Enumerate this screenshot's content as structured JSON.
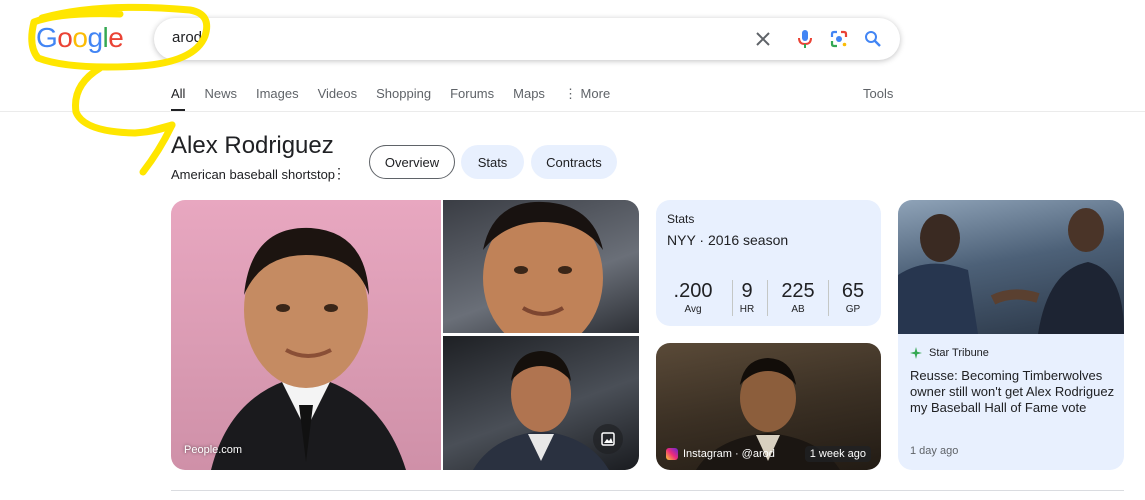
{
  "logo": {
    "letters": [
      "G",
      "o",
      "o",
      "g",
      "l",
      "e"
    ]
  },
  "search": {
    "query": "arod"
  },
  "tabs": [
    {
      "label": "All"
    },
    {
      "label": "News"
    },
    {
      "label": "Images"
    },
    {
      "label": "Videos"
    },
    {
      "label": "Shopping"
    },
    {
      "label": "Forums"
    },
    {
      "label": "Maps"
    },
    {
      "label": "⋮ More"
    }
  ],
  "tools_label": "Tools",
  "entity": {
    "title": "Alex Rodriguez",
    "subtitle": "American baseball shortstop",
    "chips": {
      "overview": "Overview",
      "stats": "Stats",
      "contracts": "Contracts"
    }
  },
  "images": {
    "main_source": "People.com"
  },
  "stats_card": {
    "label": "Stats",
    "season": "NYY · 2016 season",
    "items": [
      {
        "value": ".200",
        "label": "Avg"
      },
      {
        "value": "9",
        "label": "HR"
      },
      {
        "value": "225",
        "label": "AB"
      },
      {
        "value": "65",
        "label": "GP"
      }
    ]
  },
  "instagram_card": {
    "caption": "Instagram · @arod",
    "time": "1 week ago"
  },
  "news_card": {
    "source": "Star Tribune",
    "title": "Reusse: Becoming Timberwolves owner still won't get Alex Rodriguez my Baseball Hall of Fame vote",
    "time": "1 day ago"
  },
  "colors": {
    "accent_blue": "#4285f4",
    "chip_bg": "#e8f0fe",
    "scribble": "#ffe600"
  }
}
